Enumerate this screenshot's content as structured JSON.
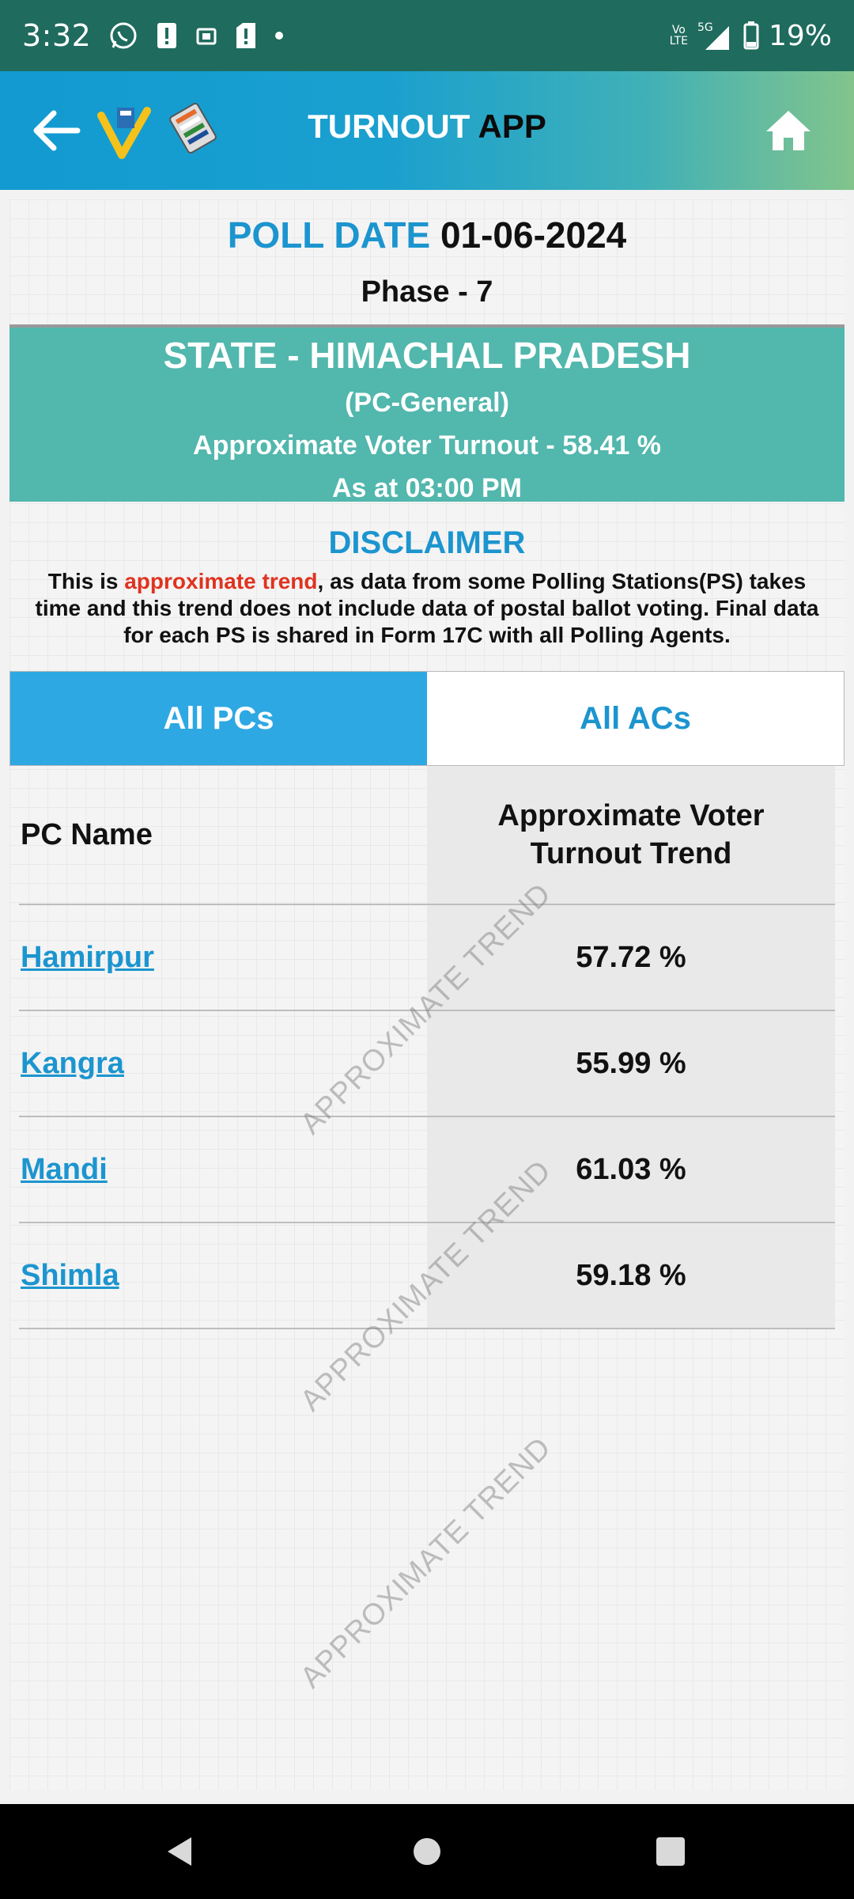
{
  "status_bar": {
    "time": "3:32",
    "network_top": "Vo",
    "network_bottom": "LTE",
    "network_5g": "5G",
    "battery": "19%",
    "icons": [
      "whatsapp-icon",
      "alert-icon",
      "sim-icon",
      "alert-icon",
      "dot-icon",
      "signal-icon",
      "battery-icon"
    ]
  },
  "header": {
    "title_part1": "TURNOUT ",
    "title_part2": "APP",
    "icons": [
      "back-arrow-icon",
      "voter-logo-icon",
      "evm-logo-icon",
      "home-icon"
    ]
  },
  "poll": {
    "date_label": "POLL DATE",
    "date_value": "01-06-2024",
    "phase": "Phase - 7"
  },
  "state": {
    "name": "STATE - HIMACHAL PRADESH",
    "type": "(PC-General)",
    "turnout": "Approximate Voter Turnout - 58.41 %",
    "as_at": "As at 03:00 PM"
  },
  "disclaimer": {
    "title": "DISCLAIMER",
    "text_before": "This is ",
    "text_highlight": "approximate trend",
    "text_after": ", as data from some Polling Stations(PS) takes time and this trend does not include data of postal ballot voting. Final data for each PS is shared in Form 17C with all Polling Agents."
  },
  "tabs": [
    {
      "label": "All PCs",
      "active": true
    },
    {
      "label": "All ACs",
      "active": false
    }
  ],
  "table": {
    "headers": [
      "PC Name",
      "Approximate Voter Turnout Trend"
    ],
    "rows": [
      {
        "name": "Hamirpur",
        "value": "57.72 %"
      },
      {
        "name": "Kangra",
        "value": "55.99 %"
      },
      {
        "name": "Mandi",
        "value": "61.03 %"
      },
      {
        "name": "Shimla",
        "value": "59.18 %"
      }
    ]
  },
  "watermark": "APPROXIMATE TREND",
  "colors": {
    "status_bar": "#1f6b5e",
    "accent_blue": "#1c95cf",
    "banner_teal": "#52b7ad",
    "active_tab": "#2ea8e3",
    "highlight_red": "#e0331f"
  }
}
